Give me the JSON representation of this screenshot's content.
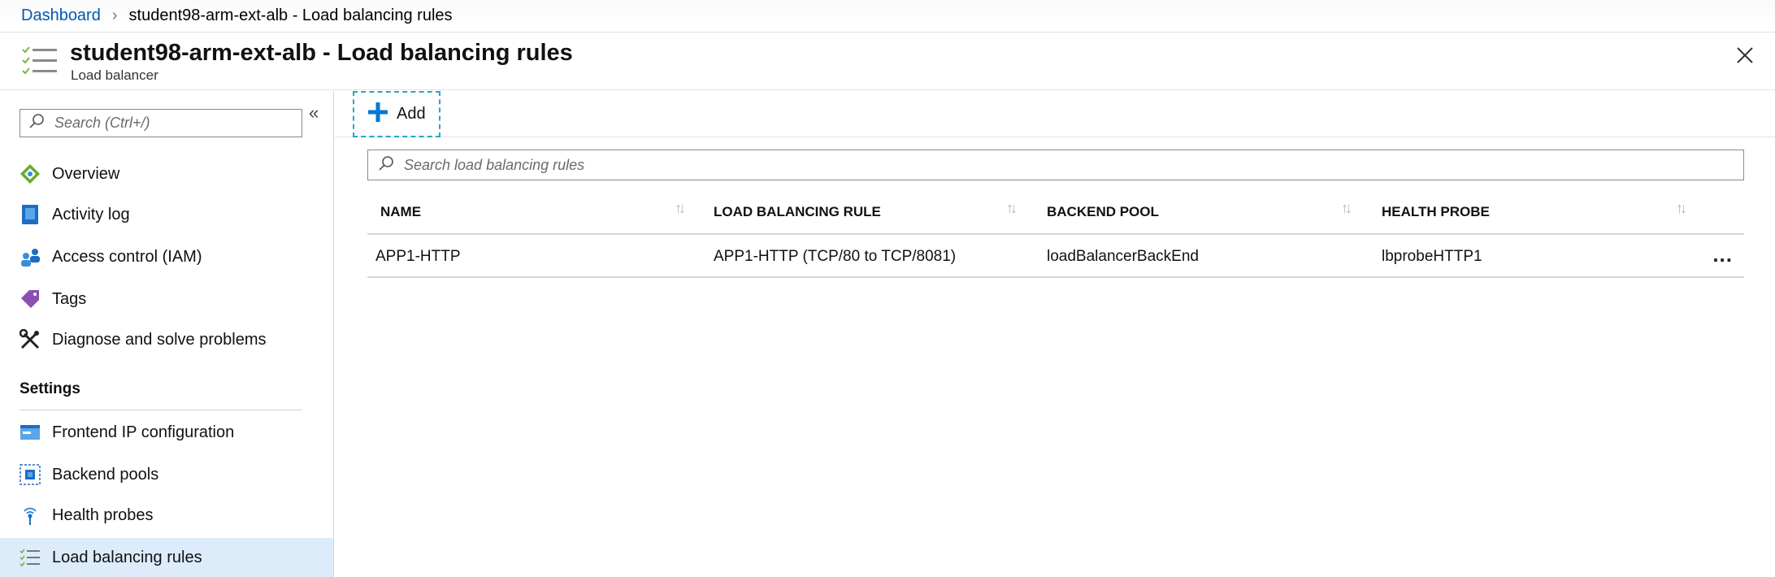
{
  "breadcrumb": {
    "root": "Dashboard",
    "current": "student98-arm-ext-alb - Load balancing rules"
  },
  "header": {
    "title": "student98-arm-ext-alb - Load balancing rules",
    "subtitle": "Load balancer",
    "icon": "list-checks-icon"
  },
  "sidebar": {
    "search_placeholder": "Search (Ctrl+/)",
    "collapse_glyph": "«",
    "items": [
      {
        "label": "Overview",
        "icon": "overview-icon"
      },
      {
        "label": "Activity log",
        "icon": "activity-log-icon"
      },
      {
        "label": "Access control (IAM)",
        "icon": "iam-icon"
      },
      {
        "label": "Tags",
        "icon": "tag-icon"
      },
      {
        "label": "Diagnose and solve problems",
        "icon": "wrench-icon"
      }
    ],
    "section_label": "Settings",
    "settings_items": [
      {
        "label": "Frontend IP configuration",
        "icon": "frontend-ip-icon"
      },
      {
        "label": "Backend pools",
        "icon": "backend-pool-icon"
      },
      {
        "label": "Health probes",
        "icon": "health-probe-icon"
      },
      {
        "label": "Load balancing rules",
        "icon": "lb-rules-icon",
        "selected": true
      }
    ]
  },
  "toolbar": {
    "add_label": "Add"
  },
  "table": {
    "search_placeholder": "Search load balancing rules",
    "columns": [
      "NAME",
      "LOAD BALANCING RULE",
      "BACKEND POOL",
      "HEALTH PROBE"
    ],
    "rows": [
      {
        "name": "APP1-HTTP",
        "rule": "APP1-HTTP (TCP/80 to TCP/8081)",
        "backend_pool": "loadBalancerBackEnd",
        "health_probe": "lbprobeHTTP1"
      }
    ],
    "more_glyph": "..."
  },
  "colors": {
    "link": "#0058ad",
    "selected_bg": "#dcecfb",
    "accent_blue": "#0078d4",
    "dashed_border": "#2aa4c7"
  }
}
